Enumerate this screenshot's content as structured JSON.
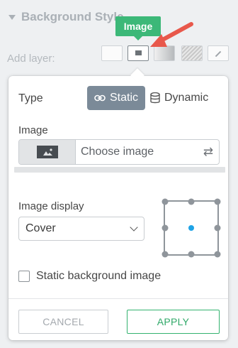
{
  "background": {
    "section_title": "Background Style",
    "add_layer_label": "Add layer:",
    "layer_types": [
      "solid",
      "image",
      "gradient",
      "pattern",
      "picker"
    ]
  },
  "tooltip": {
    "text": "Image"
  },
  "popup": {
    "type_label": "Type",
    "type_options": {
      "static": "Static",
      "dynamic": "Dynamic",
      "selected": "static"
    },
    "image_label": "Image",
    "image_placeholder": "Choose image",
    "image_display_label": "Image display",
    "image_display_value": "Cover",
    "position_selected": "center",
    "static_checkbox_label": "Static background image",
    "static_checkbox_checked": false,
    "cancel_label": "CANCEL",
    "apply_label": "APPLY"
  },
  "colors": {
    "accent_green": "#3cb878",
    "selected_segment": "#7b8a98",
    "position_active": "#1fa3e6",
    "arrow": "#e8584b"
  }
}
